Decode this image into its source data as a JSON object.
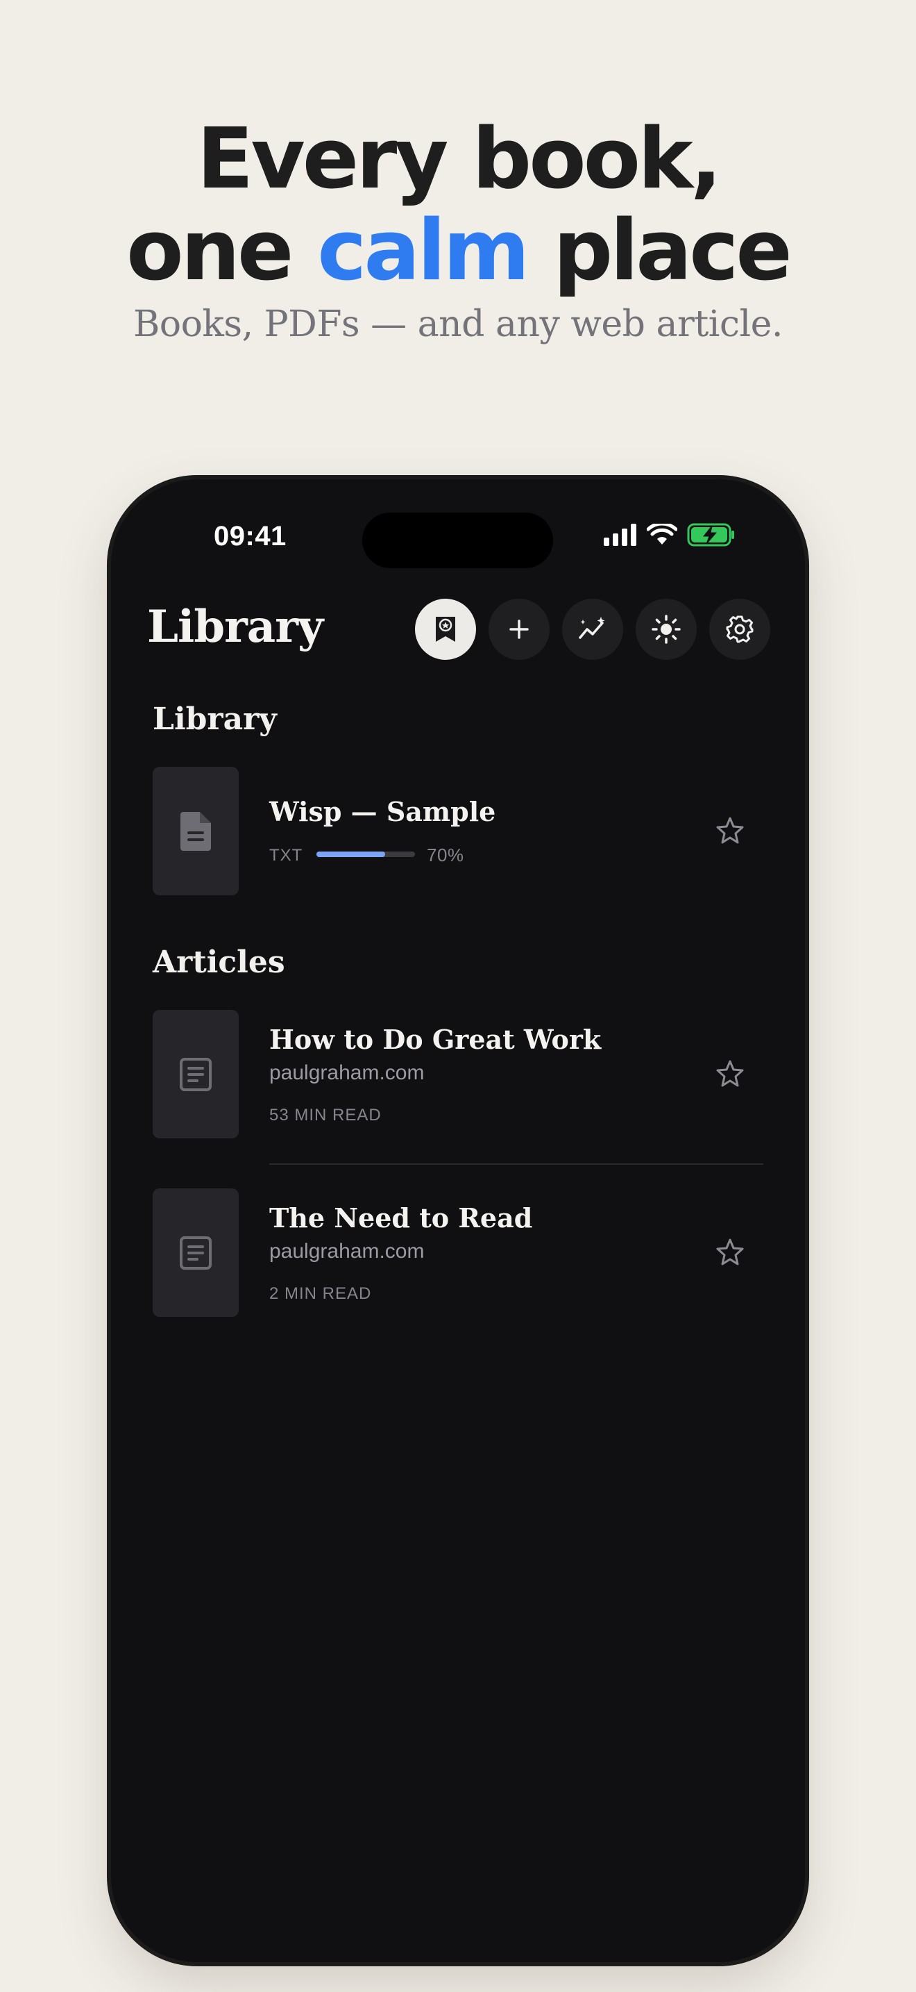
{
  "hero": {
    "line1": "Every book,",
    "line2_a": "one ",
    "line2_accent": "calm",
    "line2_b": " place",
    "subtitle": "Books, PDFs — and any web article."
  },
  "status_bar": {
    "time": "09:41"
  },
  "header": {
    "title": "Library",
    "buttons": [
      {
        "icon": "award-ribbon-icon",
        "active": true
      },
      {
        "icon": "plus-icon",
        "active": false
      },
      {
        "icon": "sparkle-chart-icon",
        "active": false
      },
      {
        "icon": "sun-icon",
        "active": false
      },
      {
        "icon": "gear-icon",
        "active": false
      }
    ]
  },
  "library": {
    "section_title": "Library",
    "items": [
      {
        "title": "Wisp — Sample",
        "format": "TXT",
        "progress_percent": 70,
        "progress_label": "70%",
        "icon": "document-icon"
      }
    ]
  },
  "articles": {
    "section_title": "Articles",
    "items": [
      {
        "title": "How to Do Great Work",
        "domain": "paulgraham.com",
        "read_time": "53 MIN READ",
        "icon": "article-icon"
      },
      {
        "title": "The Need to Read",
        "domain": "paulgraham.com",
        "read_time": "2 MIN READ",
        "icon": "article-icon"
      }
    ]
  },
  "colors": {
    "accent": "#2f7cf0",
    "progress": "#7aa6f5",
    "battery": "#34c759",
    "phone_bg": "#101012",
    "page_bg": "#f1eee8"
  }
}
